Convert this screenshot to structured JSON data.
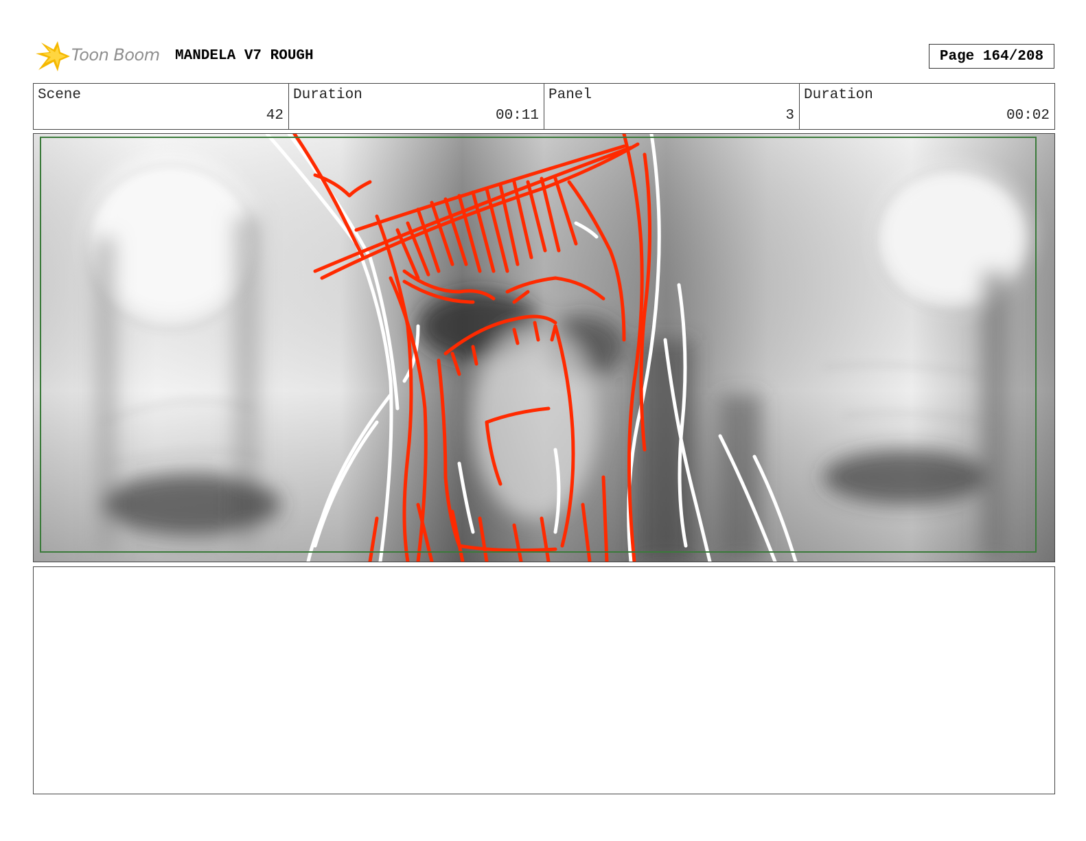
{
  "header": {
    "logo_text": "Toon Boom",
    "project_title": "MANDELA V7 ROUGH",
    "page_indicator": "Page 164/208"
  },
  "info": {
    "scene_label": "Scene",
    "scene_value": "42",
    "scene_duration_label": "Duration",
    "scene_duration_value": "00:11",
    "panel_label": "Panel",
    "panel_value": "3",
    "panel_duration_label": "Duration",
    "panel_duration_value": "00:02"
  },
  "panel": {
    "safe_frame_color": "#3a7a3a",
    "sketch_color": "#ff2a00"
  },
  "notes": {
    "text": ""
  }
}
